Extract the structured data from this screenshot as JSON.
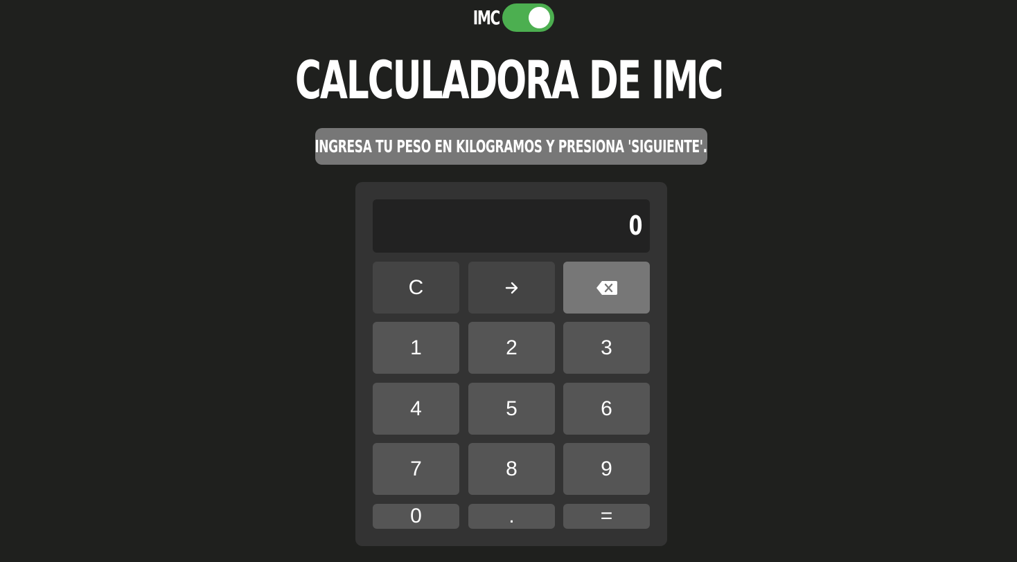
{
  "toggle": {
    "label": "IMC",
    "state": "on",
    "color": "#4caf50"
  },
  "title": "CALCULADORA DE IMC",
  "instruction": "INGRESA TU PESO EN KILOGRAMOS Y PRESIONA 'SIGUIENTE'.",
  "display": {
    "value": "0"
  },
  "keys": {
    "clear": "C",
    "next_icon": "arrow-right-icon",
    "backspace_icon": "backspace-icon",
    "one": "1",
    "two": "2",
    "three": "3",
    "four": "4",
    "five": "5",
    "six": "6",
    "seven": "7",
    "eight": "8",
    "nine": "9",
    "zero": "0",
    "dot": ".",
    "equals": "="
  },
  "colors": {
    "background": "#1f201e",
    "panel": "#333333",
    "display": "#222222",
    "key": "#555555",
    "key_dark": "#444444",
    "key_light": "#777777",
    "accent": "#4caf50"
  }
}
